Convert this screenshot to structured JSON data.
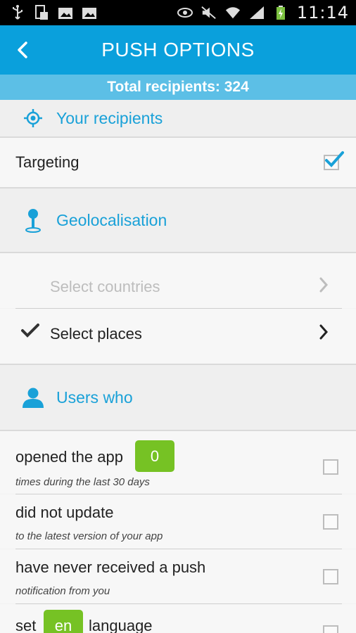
{
  "status_bar": {
    "time": "11:14",
    "icons": [
      "usb-icon",
      "screenshot-icon",
      "image-icon",
      "image-icon",
      "eye-icon",
      "mute-icon",
      "wifi-icon",
      "signal-icon",
      "battery-charging-icon"
    ]
  },
  "app_bar": {
    "title": "PUSH OPTIONS",
    "back_icon": "chevron-left-icon"
  },
  "recipients": {
    "text": "Total recipients: 324"
  },
  "your_recipients": {
    "title": "Your recipients",
    "icon": "target-icon"
  },
  "targeting": {
    "label": "Targeting",
    "checked": true
  },
  "geolocalisation": {
    "title": "Geolocalisation",
    "icon": "map-pin-icon",
    "items": [
      {
        "label": "Select countries",
        "checked": false
      },
      {
        "label": "Select places",
        "checked": true
      }
    ]
  },
  "users_who": {
    "title": "Users who",
    "icon": "user-icon",
    "conditions": [
      {
        "prefix": "opened the app",
        "pill": "0",
        "suffix": "",
        "sub": "times during the last 30 days"
      },
      {
        "prefix": "did not update",
        "pill": "",
        "suffix": "",
        "sub": "to the latest version of your app"
      },
      {
        "prefix": "have never received a push",
        "pill": "",
        "suffix": "",
        "sub": "notification from you"
      },
      {
        "prefix": "set",
        "pill": "en",
        "suffix": "language",
        "sub": ""
      }
    ]
  },
  "colors": {
    "app_bar": "#0aa0dc",
    "recipients_bar": "#5cbfe6",
    "accent": "#19a1d8",
    "pill": "#76c224"
  }
}
